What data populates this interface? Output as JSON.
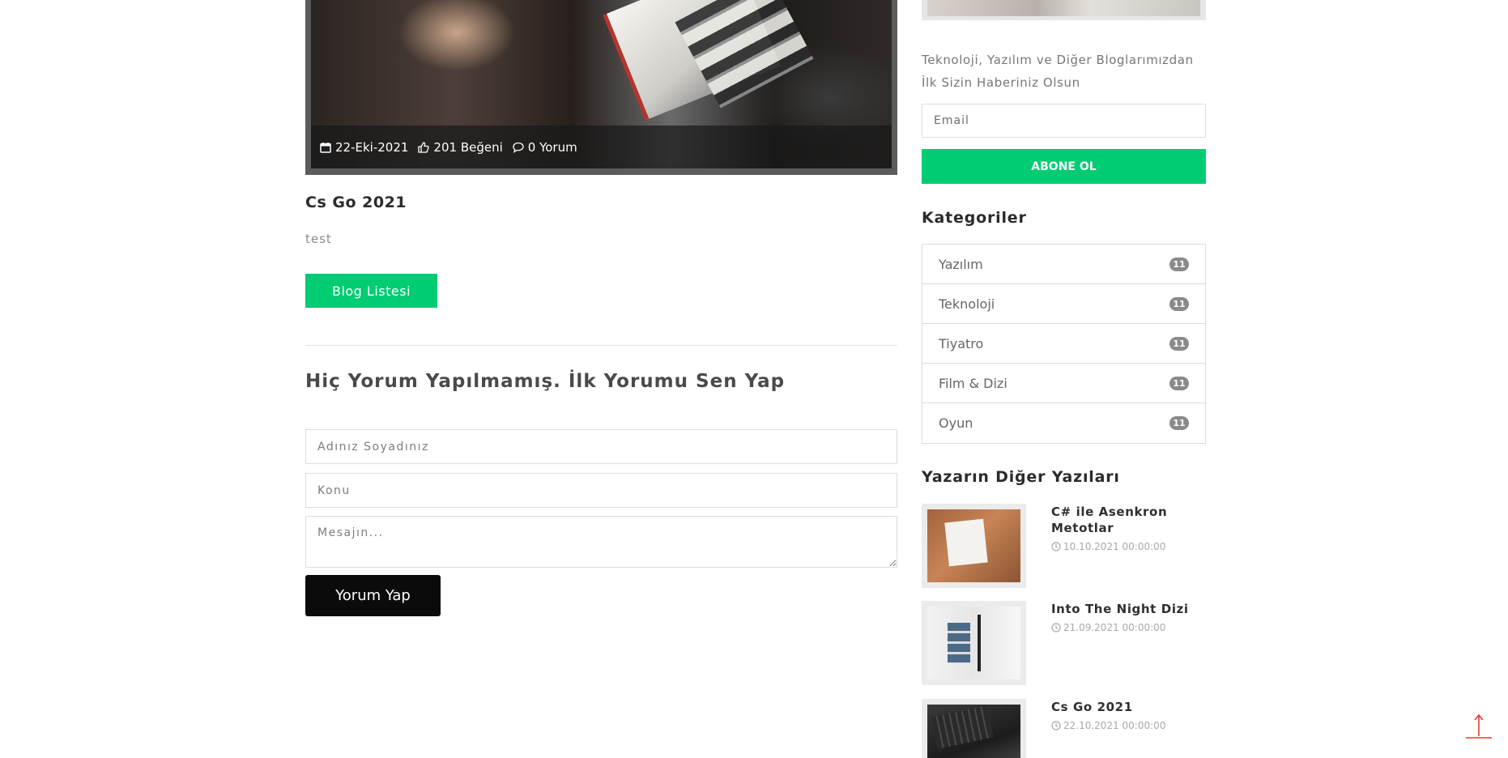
{
  "post": {
    "date": "22-Eki-2021",
    "likes": "201 Beğeni",
    "comments": "0 Yorum",
    "title": "Cs Go 2021",
    "text": "test",
    "blog_list_label": "Blog Listesi"
  },
  "comment_form": {
    "heading": "Hiç Yorum Yapılmamış. İlk Yorumu Sen Yap",
    "name_placeholder": "Adınız Soyadınız",
    "subject_placeholder": "Konu",
    "message_placeholder": "Mesajın...",
    "submit_label": "Yorum Yap"
  },
  "sidebar": {
    "newsletter_text": "Teknoloji, Yazılım ve Diğer Bloglarımızdan İlk Sizin Haberiniz Olsun",
    "email_placeholder": "Email",
    "subscribe_label": "ABONE OL",
    "categories_heading": "Kategoriler",
    "categories": [
      {
        "name": "Yazılım",
        "count": "11"
      },
      {
        "name": "Teknoloji",
        "count": "11"
      },
      {
        "name": "Tiyatro",
        "count": "11"
      },
      {
        "name": "Film & Dizi",
        "count": "11"
      },
      {
        "name": "Oyun",
        "count": "11"
      }
    ],
    "other_posts_heading": "Yazarın Diğer Yazıları",
    "other_posts": [
      {
        "title": "C# ile Asenkron Metotlar",
        "date": "10.10.2021 00:00:00"
      },
      {
        "title": "Into The Night Dizi",
        "date": "21.09.2021 00:00:00"
      },
      {
        "title": "Cs Go 2021",
        "date": "22.10.2021 00:00:00"
      }
    ]
  },
  "colors": {
    "accent_green": "#00cc73",
    "dark_button": "#0b0b0b",
    "scroll_top_red": "#e53935"
  },
  "icons": [
    "calendar-icon",
    "thumbs-up-icon",
    "comment-icon",
    "clock-icon",
    "arrow-up-icon"
  ]
}
